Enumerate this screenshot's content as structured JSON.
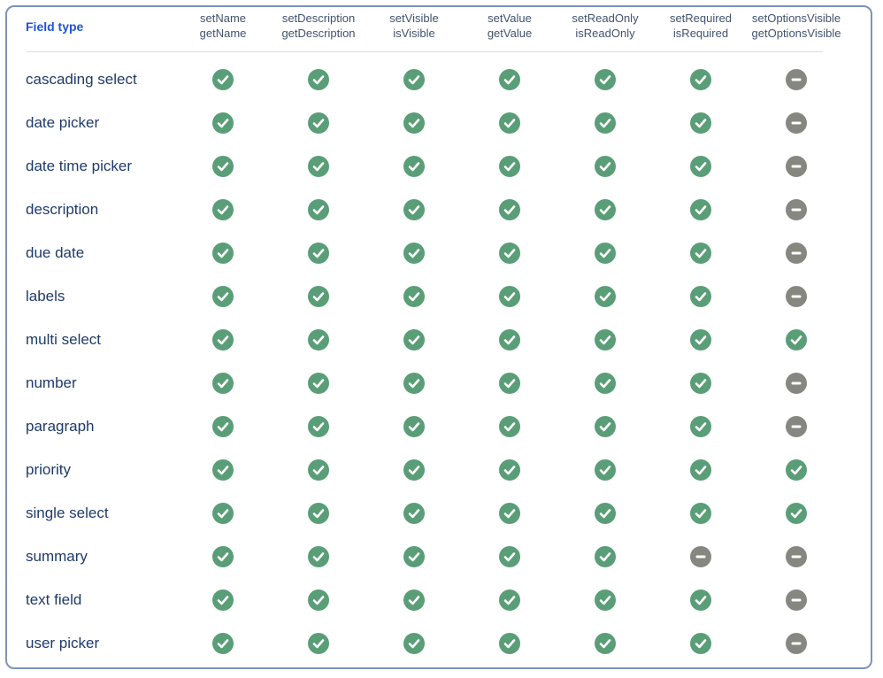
{
  "table": {
    "columns": [
      {
        "label": "Field type"
      },
      {
        "label": "setName\ngetName"
      },
      {
        "label": "setDescription\ngetDescription"
      },
      {
        "label": "setVisible\nisVisible"
      },
      {
        "label": "setValue\ngetValue"
      },
      {
        "label": "setReadOnly\nisReadOnly"
      },
      {
        "label": "setRequired\nisRequired"
      },
      {
        "label": "setOptionsVisible\ngetOptionsVisible"
      }
    ],
    "rows": [
      {
        "field": "cascading select",
        "support": [
          1,
          1,
          1,
          1,
          1,
          1,
          0
        ]
      },
      {
        "field": "date picker",
        "support": [
          1,
          1,
          1,
          1,
          1,
          1,
          0
        ]
      },
      {
        "field": "date time picker",
        "support": [
          1,
          1,
          1,
          1,
          1,
          1,
          0
        ]
      },
      {
        "field": "description",
        "support": [
          1,
          1,
          1,
          1,
          1,
          1,
          0
        ]
      },
      {
        "field": "due date",
        "support": [
          1,
          1,
          1,
          1,
          1,
          1,
          0
        ]
      },
      {
        "field": "labels",
        "support": [
          1,
          1,
          1,
          1,
          1,
          1,
          0
        ]
      },
      {
        "field": "multi select",
        "support": [
          1,
          1,
          1,
          1,
          1,
          1,
          1
        ]
      },
      {
        "field": "number",
        "support": [
          1,
          1,
          1,
          1,
          1,
          1,
          0
        ]
      },
      {
        "field": "paragraph",
        "support": [
          1,
          1,
          1,
          1,
          1,
          1,
          0
        ]
      },
      {
        "field": "priority",
        "support": [
          1,
          1,
          1,
          1,
          1,
          1,
          1
        ]
      },
      {
        "field": "single select",
        "support": [
          1,
          1,
          1,
          1,
          1,
          1,
          1
        ]
      },
      {
        "field": "summary",
        "support": [
          1,
          1,
          1,
          1,
          1,
          0,
          0
        ]
      },
      {
        "field": "text field",
        "support": [
          1,
          1,
          1,
          1,
          1,
          1,
          0
        ]
      },
      {
        "field": "user picker",
        "support": [
          1,
          1,
          1,
          1,
          1,
          1,
          0
        ]
      }
    ]
  },
  "icons": {
    "supported": "check-circle-icon",
    "unsupported": "minus-circle-icon"
  },
  "colors": {
    "supported": "#5a9e78",
    "unsupported": "#858780",
    "header_link": "#1f55d6",
    "label": "#1f3a6b",
    "border": "#7d93b8"
  }
}
